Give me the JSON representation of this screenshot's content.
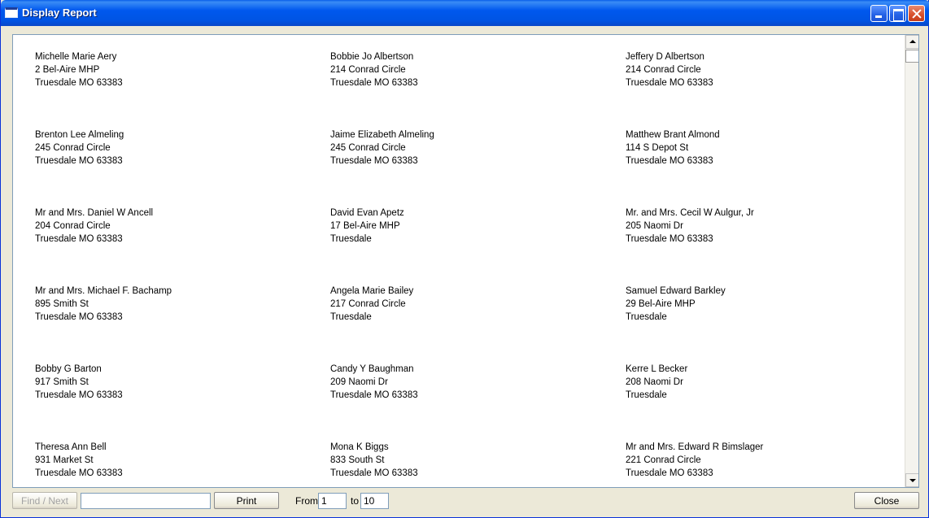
{
  "window": {
    "title": "Display Report"
  },
  "labels": [
    {
      "name": "Michelle Marie Aery",
      "address": "2 Bel-Aire MHP",
      "city": "Truesdale  MO  63383"
    },
    {
      "name": "Bobbie Jo Albertson",
      "address": "214 Conrad Circle",
      "city": "Truesdale  MO  63383"
    },
    {
      "name": "Jeffery D Albertson",
      "address": "214 Conrad Circle",
      "city": "Truesdale  MO  63383"
    },
    {
      "name": "Brenton Lee Almeling",
      "address": "245 Conrad Circle",
      "city": "Truesdale  MO  63383"
    },
    {
      "name": "Jaime Elizabeth Almeling",
      "address": "245 Conrad Circle",
      "city": "Truesdale  MO  63383"
    },
    {
      "name": "Matthew Brant Almond",
      "address": "114 S Depot St",
      "city": "Truesdale  MO  63383"
    },
    {
      "name": "Mr and Mrs. Daniel W Ancell",
      "address": "204 Conrad Circle",
      "city": "Truesdale  MO  63383"
    },
    {
      "name": "David Evan Apetz",
      "address": "17 Bel-Aire MHP",
      "city": "Truesdale"
    },
    {
      "name": "Mr. and Mrs. Cecil W Aulgur, Jr",
      "address": "205 Naomi Dr",
      "city": "Truesdale  MO  63383"
    },
    {
      "name": "Mr and Mrs. Michael F. Bachamp",
      "address": "895 Smith St",
      "city": "Truesdale  MO  63383"
    },
    {
      "name": "Angela Marie Bailey",
      "address": "217 Conrad Circle",
      "city": "Truesdale"
    },
    {
      "name": "Samuel Edward Barkley",
      "address": "29 Bel-Aire MHP",
      "city": "Truesdale"
    },
    {
      "name": "Bobby G Barton",
      "address": "917 Smith St",
      "city": "Truesdale  MO  63383"
    },
    {
      "name": "Candy Y Baughman",
      "address": "209 Naomi Dr",
      "city": "Truesdale  MO  63383"
    },
    {
      "name": "Kerre L Becker",
      "address": "208 Naomi Dr",
      "city": "Truesdale"
    },
    {
      "name": "Theresa Ann Bell",
      "address": "931 Market St",
      "city": "Truesdale  MO  63383"
    },
    {
      "name": "Mona K Biggs",
      "address": "833 South St",
      "city": "Truesdale  MO  63383"
    },
    {
      "name": "Mr and Mrs. Edward R Bimslager",
      "address": "221 Conrad Circle",
      "city": "Truesdale  MO  63383"
    }
  ],
  "bottom": {
    "find_next_label": "Find / Next",
    "find_value": "",
    "print_label": "Print",
    "from_label": "From",
    "from_value": "1",
    "to_label": "to",
    "to_value": "10",
    "close_label": "Close"
  },
  "icons": {
    "window_icon": "window-icon",
    "minimize": "minimize-icon",
    "maximize": "maximize-icon",
    "close": "close-icon",
    "scroll_up": "arrow-up-icon",
    "scroll_down": "arrow-down-icon"
  }
}
